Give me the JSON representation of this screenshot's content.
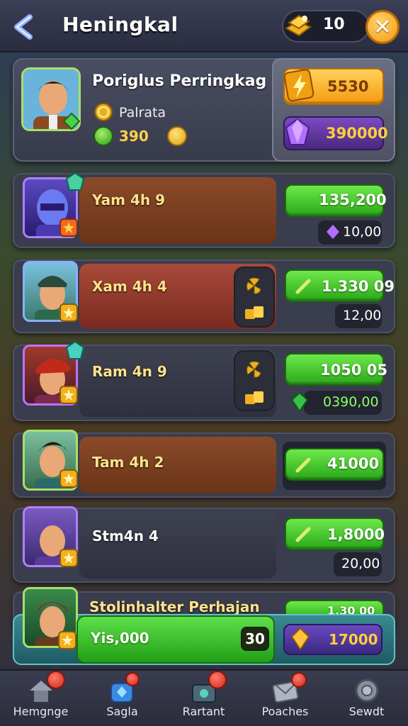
{
  "header": {
    "title": "Heningkal",
    "back_icon": "back-arrow-icon",
    "currency_value": "10",
    "close_label": "✕"
  },
  "profile": {
    "name": "Poriglus Perringkag",
    "subtitle": "Palrata",
    "score": "390",
    "gold_button_value": "5530",
    "purple_button_value": "390000"
  },
  "rows": [
    {
      "name": "Yam 4h 9",
      "value": "135,200",
      "sub_value": "10,00"
    },
    {
      "name": "Xam 4h 4",
      "value": "1.330 09",
      "sub_value": "12,00"
    },
    {
      "name": "Ram 4n 9",
      "value": "1050 05",
      "sub_value": "0390,00"
    },
    {
      "name": "Tam 4h 2",
      "value": "41000",
      "sub_value": ""
    },
    {
      "name": "Stm4n 4",
      "value": "1,8000",
      "sub_value": "20,00"
    }
  ],
  "partial_row": {
    "name": "Stolinhalter Perhajan",
    "value": "1,30 00"
  },
  "self_row": {
    "label": "Yis,000",
    "count": "30",
    "value": "17000"
  },
  "nav": [
    {
      "label": "Hemgnge",
      "icon": "home-icon"
    },
    {
      "label": "Sagla",
      "icon": "gem-box-icon"
    },
    {
      "label": "Rartant",
      "icon": "chest-icon"
    },
    {
      "label": "Poaches",
      "icon": "mail-icon"
    },
    {
      "label": "Sewdt",
      "icon": "settings-icon"
    }
  ],
  "colors": {
    "accent_green": "#2aa81a",
    "accent_orange": "#f59a12",
    "accent_purple": "#4a2880"
  }
}
